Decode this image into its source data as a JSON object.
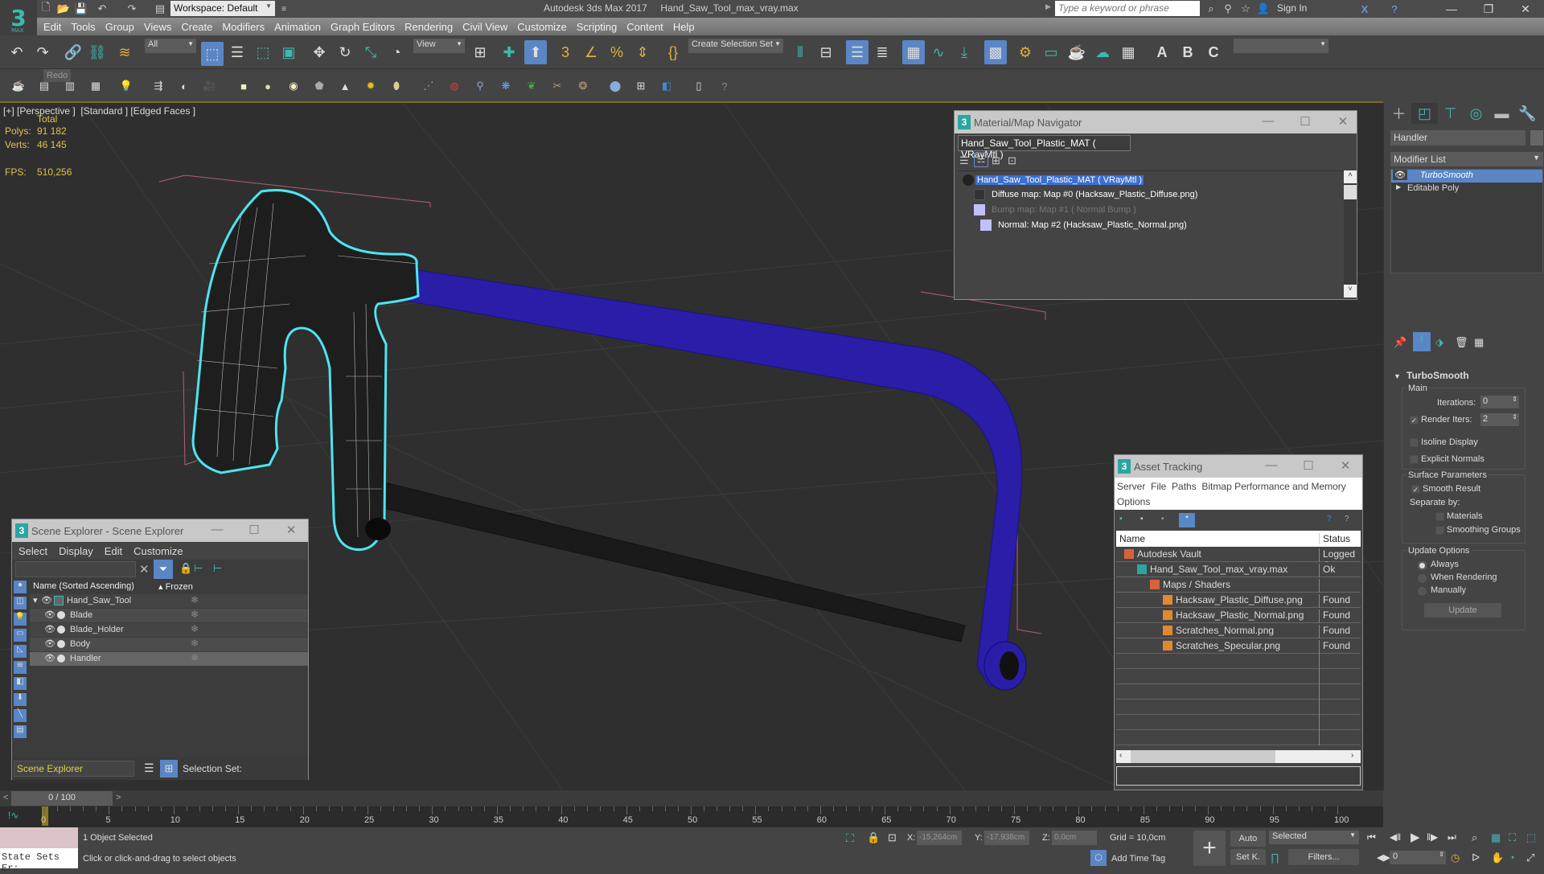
{
  "app": {
    "title": "Autodesk 3ds Max 2017",
    "file": "Hand_Saw_Tool_max_vray.max",
    "logo": "3",
    "logo_sub": "MAX",
    "workspace": "Workspace: Default",
    "search_placeholder": "Type a keyword or phrase",
    "sign_in": "Sign In"
  },
  "menu": [
    "Edit",
    "Tools",
    "Group",
    "Views",
    "Create",
    "Modifiers",
    "Animation",
    "Graph Editors",
    "Rendering",
    "Civil View",
    "Customize",
    "Scripting",
    "Content",
    "Help"
  ],
  "toolbar": {
    "selection_filter": "All",
    "ref_coord": "View",
    "create_selection_set": "Create Selection Set",
    "tooltip": "Redo",
    "text_buttons": [
      "A",
      "B",
      "C"
    ]
  },
  "viewport": {
    "label": "[+] [Perspective ]  [Standard ] [Edged Faces ]",
    "stats_header": "Total",
    "polys_label": "Polys:",
    "polys": "91 182",
    "verts_label": "Verts:",
    "verts": "46 145",
    "fps_label": "FPS:",
    "fps": "510,256",
    "selection_color": "#4fe3f0",
    "frame_color": "#2a1ea8"
  },
  "material_navigator": {
    "title": "Material/Map Navigator",
    "current": "Hand_Saw_Tool_Plastic_MAT  ( VRayMtl )",
    "tree": [
      {
        "label": "Hand_Saw_Tool_Plastic_MAT  ( VRayMtl )",
        "selected": true
      },
      {
        "label": "Diffuse map: Map #0 (Hacksaw_Plastic_Diffuse.png)"
      },
      {
        "label": "Bump map: Map #1  ( Normal Bump )",
        "dim": true
      },
      {
        "label": "Normal: Map #2 (Hacksaw_Plastic_Normal.png)"
      }
    ]
  },
  "asset_tracking": {
    "title": "Asset Tracking",
    "menu": [
      "Server",
      "File",
      "Paths",
      "Bitmap Performance and Memory",
      "Options"
    ],
    "columns": [
      "Name",
      "Status"
    ],
    "rows": [
      {
        "name": "Autodesk Vault",
        "status": "Logged O",
        "indent": 0
      },
      {
        "name": "Hand_Saw_Tool_max_vray.max",
        "status": "Ok",
        "indent": 1
      },
      {
        "name": "Maps / Shaders",
        "status": "",
        "indent": 2
      },
      {
        "name": "Hacksaw_Plastic_Diffuse.png",
        "status": "Found",
        "indent": 3
      },
      {
        "name": "Hacksaw_Plastic_Normal.png",
        "status": "Found",
        "indent": 3
      },
      {
        "name": "Scratches_Normal.png",
        "status": "Found",
        "indent": 3
      },
      {
        "name": "Scratches_Specular.png",
        "status": "Found",
        "indent": 3
      }
    ]
  },
  "scene_explorer": {
    "title": "Scene Explorer - Scene Explorer",
    "menu": [
      "Select",
      "Display",
      "Edit",
      "Customize"
    ],
    "col_name": "Name (Sorted Ascending)",
    "col_frozen": "Frozen",
    "root": "Hand_Saw_Tool",
    "items": [
      {
        "name": "Blade",
        "selected": false
      },
      {
        "name": "Blade_Holder",
        "selected": false
      },
      {
        "name": "Body",
        "selected": false
      },
      {
        "name": "Handler",
        "selected": true
      }
    ],
    "footer_name": "Scene Explorer",
    "selection_set_label": "Selection Set:"
  },
  "command_panel": {
    "object_name": "Handler",
    "modifier_list": "Modifier List",
    "stack": [
      {
        "name": "TurboSmooth",
        "selected": true
      },
      {
        "name": "Editable Poly",
        "selected": false
      }
    ],
    "rollout": "TurboSmooth",
    "main_label": "Main",
    "iterations_label": "Iterations:",
    "iterations": "0",
    "render_iters_label": "Render Iters:",
    "render_iters": "2",
    "render_iters_checked": true,
    "isoline": "Isoline Display",
    "isoline_checked": false,
    "explicit_normals": "Explicit Normals",
    "explicit_checked": false,
    "surface_label": "Surface Parameters",
    "smooth_result": "Smooth Result",
    "smooth_checked": true,
    "separate_by": "Separate by:",
    "materials": "Materials",
    "smoothing_groups": "Smoothing Groups",
    "update_label": "Update Options",
    "update_options": [
      "Always",
      "When Rendering",
      "Manually"
    ],
    "update_selected": "Always",
    "update_button": "Update"
  },
  "timeline": {
    "frame": "0 / 100",
    "ticks": [
      "0",
      "5",
      "10",
      "15",
      "20",
      "25",
      "30",
      "35",
      "40",
      "45",
      "50",
      "55",
      "60",
      "65",
      "70",
      "75",
      "80",
      "85",
      "90",
      "95",
      "100"
    ]
  },
  "status": {
    "maxscript": "State Sets Er:",
    "selected": "1 Object Selected",
    "prompt": "Click or click-and-drag to select objects",
    "x_label": "X:",
    "x": "-15,264cm",
    "y_label": "Y:",
    "y": "-17,938cm",
    "z_label": "Z:",
    "z": "0,0cm",
    "grid": "Grid = 10,0cm",
    "add_time_tag": "Add Time Tag",
    "auto": "Auto",
    "set_key": "Set K.",
    "key_filter": "Selected",
    "filters": "Filters...",
    "current_frame": "0"
  }
}
